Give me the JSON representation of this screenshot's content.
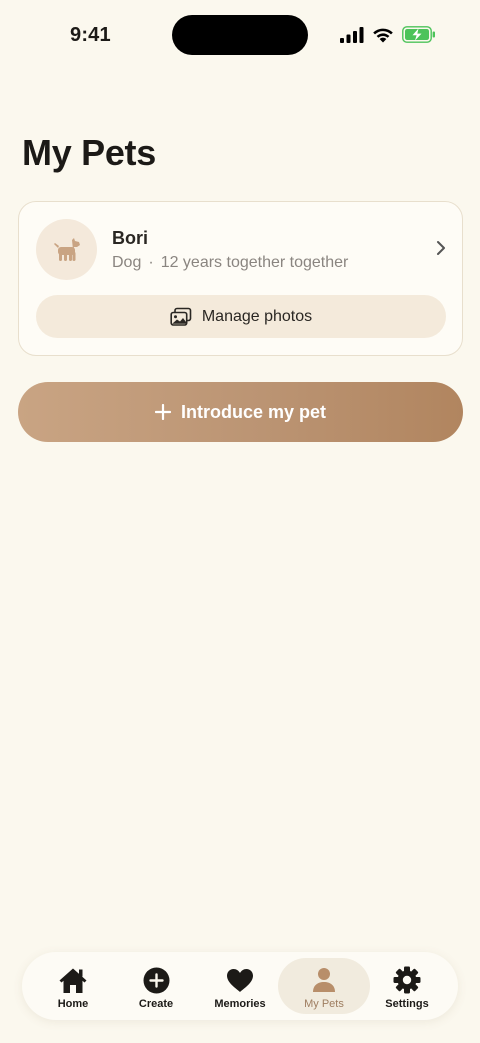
{
  "status_bar": {
    "time": "9:41"
  },
  "page": {
    "title": "My Pets"
  },
  "pet": {
    "name": "Bori",
    "species": "Dog",
    "separator": "·",
    "duration": "12 years together together",
    "manage_label": "Manage photos"
  },
  "actions": {
    "introduce_label": "Introduce my pet"
  },
  "tabs": [
    {
      "label": "Home",
      "icon": "home-icon"
    },
    {
      "label": "Create",
      "icon": "plus-circle-icon"
    },
    {
      "label": "Memories",
      "icon": "heart-icon"
    },
    {
      "label": "My Pets",
      "icon": "person-icon",
      "active": true
    },
    {
      "label": "Settings",
      "icon": "gear-icon"
    }
  ],
  "colors": {
    "accent": "#b88e6a",
    "background": "#fbf8ee",
    "battery": "#4cc35a"
  }
}
